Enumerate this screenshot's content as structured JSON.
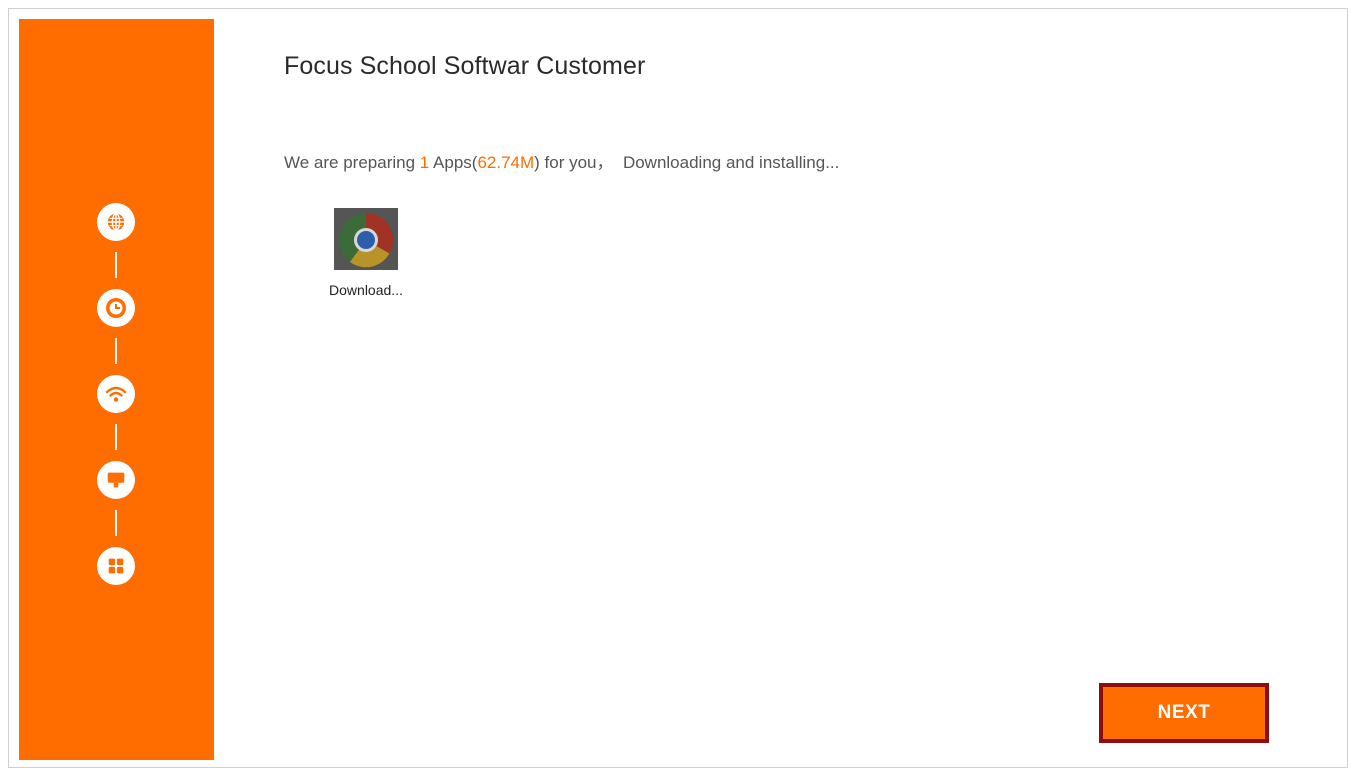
{
  "header": {
    "title": "Focus School Softwar Customer"
  },
  "status": {
    "prefix": "We are preparing ",
    "app_count": "1",
    "apps_word": " Apps(",
    "size": "62.74M",
    "suffix": ") for you，  Downloading and installing..."
  },
  "sidebar": {
    "accent_color": "#ff6c00",
    "steps": [
      {
        "icon": "globe-icon"
      },
      {
        "icon": "clock-icon"
      },
      {
        "icon": "wifi-icon"
      },
      {
        "icon": "monitor-icon"
      },
      {
        "icon": "apps-grid-icon"
      }
    ]
  },
  "apps": [
    {
      "name_label": "Download...",
      "icon": "chrome-icon"
    }
  ],
  "footer": {
    "next_label": "NEXT"
  }
}
